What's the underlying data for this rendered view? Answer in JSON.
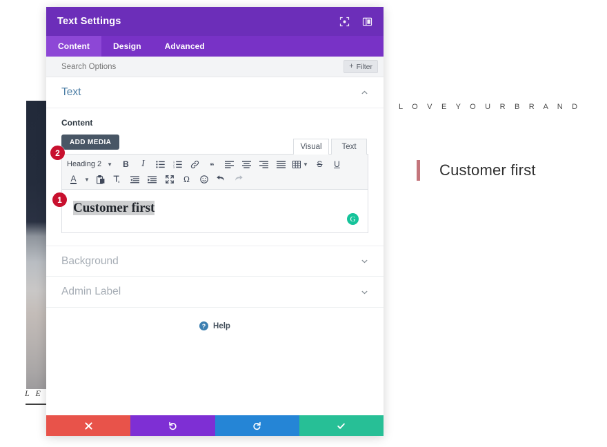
{
  "page": {
    "eyebrow": "L O V E    Y O U R    B R A N D",
    "headline": "Customer first",
    "hero_caption": "L E A",
    "accent_color": "#c4757c"
  },
  "modal": {
    "title": "Text Settings",
    "title_icons": [
      {
        "name": "focus-icon"
      },
      {
        "name": "panel-layout-icon"
      }
    ],
    "header_color": "#6c2eb9",
    "tabs_bar_color": "#7832c6",
    "tabs": [
      {
        "label": "Content",
        "active": true
      },
      {
        "label": "Design",
        "active": false
      },
      {
        "label": "Advanced",
        "active": false
      }
    ],
    "search": {
      "placeholder": "Search Options",
      "value": "",
      "filter_label": "Filter",
      "filter_plus": "+"
    },
    "sections": [
      {
        "label": "Text",
        "state": "open"
      },
      {
        "label": "Background",
        "state": "closed"
      },
      {
        "label": "Admin Label",
        "state": "closed"
      }
    ],
    "content_field": {
      "label": "Content",
      "add_media_label": "ADD MEDIA",
      "view_tabs": [
        {
          "label": "Visual",
          "active": true
        },
        {
          "label": "Text",
          "active": false
        }
      ],
      "format_select": {
        "value": "Heading 2"
      },
      "toolbar_row1": [
        {
          "name": "bold-icon",
          "glyph": "B"
        },
        {
          "name": "italic-icon",
          "glyph": "I"
        },
        {
          "name": "bulleted-list-icon",
          "glyph": "☰"
        },
        {
          "name": "numbered-list-icon",
          "glyph": "☲"
        },
        {
          "name": "link-icon",
          "glyph": "ὑ7"
        },
        {
          "name": "blockquote-icon",
          "glyph": "“"
        },
        {
          "name": "align-left-icon",
          "glyph": "≡"
        },
        {
          "name": "align-center-icon",
          "glyph": "≡"
        },
        {
          "name": "align-right-icon",
          "glyph": "≡"
        },
        {
          "name": "align-justify-icon",
          "glyph": "≡"
        },
        {
          "name": "table-icon",
          "glyph": "▦"
        },
        {
          "name": "strikethrough-icon",
          "glyph": "S"
        },
        {
          "name": "underline-icon",
          "glyph": "U"
        }
      ],
      "toolbar_row2": [
        {
          "name": "text-color-icon",
          "glyph": "A"
        },
        {
          "name": "paste-as-text-icon",
          "glyph": "ὌB"
        },
        {
          "name": "clear-formatting-icon",
          "glyph": "Tx"
        },
        {
          "name": "outdent-icon",
          "glyph": "⇤"
        },
        {
          "name": "indent-icon",
          "glyph": "⇥"
        },
        {
          "name": "fullscreen-icon",
          "glyph": "⛶"
        },
        {
          "name": "special-character-icon",
          "glyph": "Ω"
        },
        {
          "name": "emoji-icon",
          "glyph": "☺"
        },
        {
          "name": "undo-icon",
          "glyph": "↩"
        },
        {
          "name": "redo-icon",
          "glyph": "↪"
        }
      ],
      "editor_text": "Customer first",
      "editor_text_selected": true,
      "grammarly_badge": "G"
    },
    "help": {
      "label": "Help",
      "mark": "?"
    },
    "actions": [
      {
        "name": "cancel-button",
        "icon": "close-icon",
        "color": "#e8534a"
      },
      {
        "name": "undo-button",
        "icon": "undo-arrow-icon",
        "color": "#7e2fd4"
      },
      {
        "name": "redo-button",
        "icon": "redo-arrow-icon",
        "color": "#2585d6"
      },
      {
        "name": "save-button",
        "icon": "check-icon",
        "color": "#27bf96"
      }
    ]
  },
  "callouts": [
    {
      "number": "1"
    },
    {
      "number": "2"
    }
  ]
}
